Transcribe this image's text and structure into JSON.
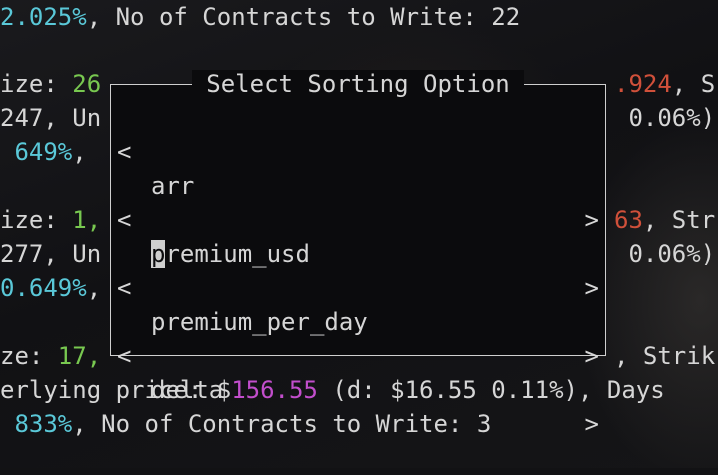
{
  "terminal": {
    "line1": {
      "a": "2.025%",
      "b": ", No of Contracts to Write: 22"
    },
    "line2": {
      "a": "ize: ",
      "b": "26"
    },
    "line2_right": {
      "a": ".924",
      "b": ", S"
    },
    "line3": {
      "a": "247, Un"
    },
    "line3_right": {
      "a": " 0.06%)"
    },
    "line4": {
      "a": " 649%",
      "b": ","
    },
    "line6": {
      "a": "ize: ",
      "b": "1,"
    },
    "line6_right": {
      "a": "63",
      "b": ", Str"
    },
    "line7": {
      "a": "277, Un"
    },
    "line7_right": {
      "a": " 0.06%)"
    },
    "line8": {
      "a": "0.649%",
      "b": ","
    },
    "line10": {
      "a": "ze: ",
      "b": "17,"
    },
    "line10_right": {
      "a": ", Strik"
    },
    "line11": {
      "a": "erlying price: $",
      "b": "156.55",
      "c": " (d: $16.55 0.11%), Days"
    },
    "line12": {
      "a": " 833%",
      "b": ", No of Contracts to Write: 3"
    }
  },
  "dialog": {
    "title": "Select Sorting Option",
    "arrow_left": "<",
    "arrow_right": ">",
    "options": [
      {
        "label": "arr"
      },
      {
        "label_first_char": "p",
        "label_rest": "remium_usd"
      },
      {
        "label": "premium_per_day"
      },
      {
        "label": "delta"
      }
    ]
  },
  "colors": {
    "cyan": "#5ac8d8",
    "green": "#78c850",
    "red": "#d0503a",
    "magenta": "#c24ecc",
    "text": "#d6d6d6"
  }
}
